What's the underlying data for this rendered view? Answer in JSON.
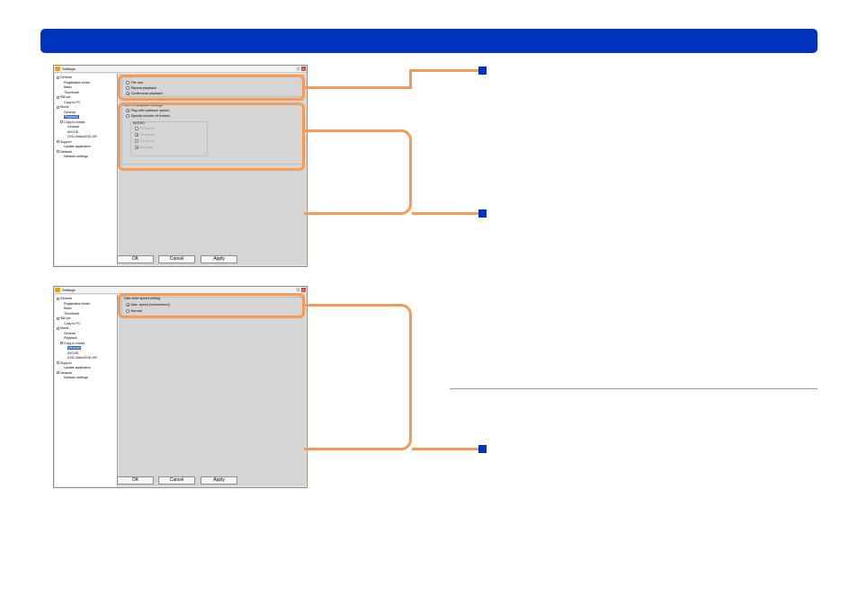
{
  "colors": {
    "header": "#0033bb",
    "callout": "#f59a57",
    "marker": "#0033bb",
    "selection": "#3366cc"
  },
  "window_title": "Settings",
  "title_buttons": {
    "help": "?",
    "close": "×"
  },
  "buttons": {
    "ok": "OK",
    "cancel": "Cancel",
    "apply": "Apply"
  },
  "tree1": [
    {
      "label": "General",
      "level": 0
    },
    {
      "label": "Registration folder",
      "level": 1
    },
    {
      "label": "Basic",
      "level": 1
    },
    {
      "label": "Thumbnail",
      "level": 1
    },
    {
      "label": "Still pic.",
      "level": 0
    },
    {
      "label": "Copy to PC",
      "level": 1
    },
    {
      "label": "Movie",
      "level": 0
    },
    {
      "label": "General",
      "level": 1
    },
    {
      "label": "Playback",
      "level": 1,
      "selected": true
    },
    {
      "label": "Copy to media",
      "level": 0.5
    },
    {
      "label": "General",
      "level": 1.5
    },
    {
      "label": "AVCHD",
      "level": 1.5
    },
    {
      "label": "DVD-Video/DVD-VR",
      "level": 1.5
    },
    {
      "label": "Support",
      "level": 0
    },
    {
      "label": "Update application",
      "level": 1
    },
    {
      "label": "Network",
      "level": 0
    },
    {
      "label": "Network settings",
      "level": 1
    }
  ],
  "tree2": [
    {
      "label": "General",
      "level": 0
    },
    {
      "label": "Registration folder",
      "level": 1
    },
    {
      "label": "Basic",
      "level": 1
    },
    {
      "label": "Thumbnail",
      "level": 1
    },
    {
      "label": "Still pic.",
      "level": 0
    },
    {
      "label": "Copy to PC",
      "level": 1
    },
    {
      "label": "Movie",
      "level": 0
    },
    {
      "label": "General",
      "level": 1
    },
    {
      "label": "Playback",
      "level": 1
    },
    {
      "label": "Copy to media",
      "level": 0.5
    },
    {
      "label": "General",
      "level": 1.5,
      "selected": true
    },
    {
      "label": "AVCHD",
      "level": 1.5
    },
    {
      "label": "DVD-Video/DVD-VR",
      "level": 1.5
    },
    {
      "label": "Support",
      "level": 0
    },
    {
      "label": "Update application",
      "level": 1
    },
    {
      "label": "Network",
      "level": 0
    },
    {
      "label": "Network settings",
      "level": 1
    }
  ],
  "playback": {
    "method_title": "Playback method",
    "options": [
      "File unit",
      "Repeat playback",
      "Continuous playback"
    ],
    "selected": 2
  },
  "avchd": {
    "title": "AVCHD playback settings",
    "play_optimum": "Play with optimum speed",
    "specify_frames": "Specify number of frames",
    "sub_title": "AVCHD",
    "frame_options": [
      "15 frames",
      "30 frames",
      "30 frames",
      "60 fields"
    ]
  },
  "disc": {
    "title": "Disc write speed setting",
    "options": [
      "Max. speed (recommend)",
      "Normal"
    ],
    "selected": 0
  }
}
